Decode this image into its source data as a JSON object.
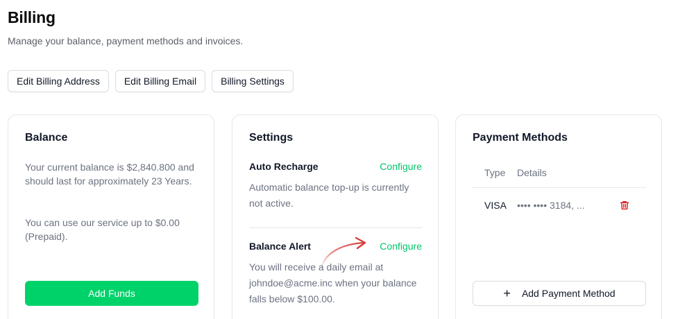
{
  "page": {
    "title": "Billing",
    "subtitle": "Manage your balance, payment methods and invoices."
  },
  "toolbar": {
    "edit_address": "Edit Billing Address",
    "edit_email": "Edit Billing Email",
    "settings": "Billing Settings"
  },
  "balance": {
    "title": "Balance",
    "text1": "Your current balance is $2,840.800 and should last for approximately 23 Years.",
    "text2": "You can use our service up to $0.00 (Prepaid).",
    "add_funds": "Add Funds",
    "accent": "#00d26a"
  },
  "settings": {
    "title": "Settings",
    "auto_recharge": {
      "label": "Auto Recharge",
      "link": "Configure",
      "desc": "Automatic balance top-up is currently not active."
    },
    "balance_alert": {
      "label": "Balance Alert",
      "link": "Configure",
      "desc": "You will receive a daily email at johndoe@acme.inc when your balance falls below $100.00."
    },
    "annotation_arrow_color": "#d93a3a"
  },
  "payments": {
    "title": "Payment Methods",
    "columns": {
      "type": "Type",
      "details": "Details"
    },
    "rows": [
      {
        "type": "VISA",
        "details": "•••• •••• 3184, ..."
      }
    ],
    "add_button": "Add Payment Method",
    "delete_color": "#dc2626"
  },
  "icons": {
    "delete": "trash-icon",
    "add": "plus-icon",
    "annotation": "curved-arrow-icon"
  }
}
